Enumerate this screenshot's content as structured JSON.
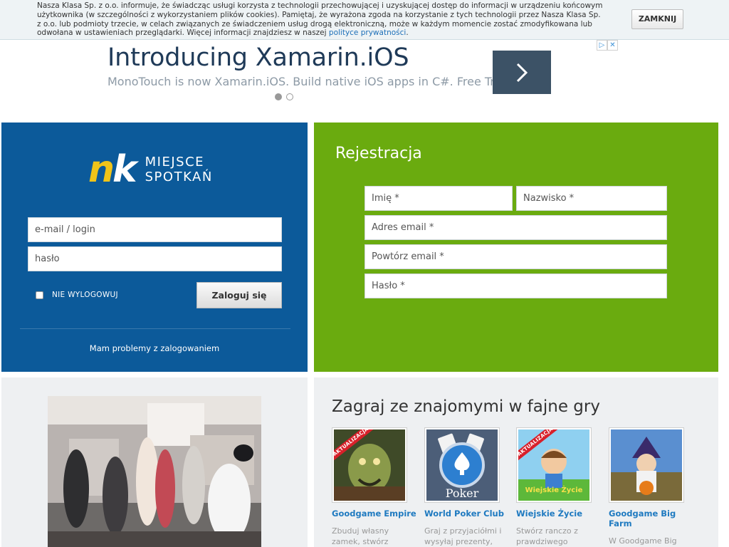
{
  "cookie_bar": {
    "text": "Nasza Klasa Sp. z o.o. informuje, że świadcząc usługi korzysta z technologii przechowującej i uzyskującej dostęp do informacji w urządzeniu końcowym użytkownika (w szczególności z wykorzystaniem plików cookies). Pamiętaj, że wyrażona zgoda na korzystanie z tych technologii przez Nasza Klasa Sp. z o.o. lub podmioty trzecie, w celach związanych ze świadczeniem usług drogą elektroniczną, może w każdym momencie zostać zmodyfikowana lub odwołana w ustawieniach przeglądarki. Więcej informacji znajdziesz w naszej ",
    "link": "polityce prywatności",
    "suffix": ".",
    "close_label": "ZAMKNIJ"
  },
  "ad": {
    "title": "Introducing Xamarin.iOS",
    "subtitle": "MonoTouch is now Xamarin.iOS. Build native iOS apps in C#. Free Trial."
  },
  "login": {
    "logo_text": "nk",
    "tagline_1": "MIEJSCE",
    "tagline_2": "SPOTKAŃ",
    "email_placeholder": "e-mail / login",
    "password_placeholder": "hasło",
    "remember_label": "NIE WYLOGOWUJ",
    "submit_label": "Zaloguj się",
    "help_link": "Mam problemy z zalogowaniem"
  },
  "register": {
    "title": "Rejestracja",
    "first_name": "Imię *",
    "last_name": "Nazwisko *",
    "email": "Adres email *",
    "email_repeat": "Powtórz email *",
    "password": "Hasło *"
  },
  "games": {
    "title": "Zagraj ze znajomymi w fajne gry",
    "badge": "AKTUALIZACJA",
    "items": [
      {
        "name": "Goodgame Empire",
        "desc": "Zbuduj własny zamek, stwórz"
      },
      {
        "name": "World Poker Club",
        "desc": "Graj z przyjaciółmi i wysyłaj prezenty,"
      },
      {
        "name": "Wiejskie Życie",
        "desc": "Stwórz ranczo z prawdziwego"
      },
      {
        "name": "Goodgame Big Farm",
        "desc": "W Goodgame Big"
      }
    ],
    "poker_logo": "Poker",
    "farm_logo": "Wiejskie Życie"
  },
  "colors": {
    "login_bg": "#0c5a9a",
    "register_bg": "#6aab0f",
    "logo_yellow": "#f0c419",
    "link_blue": "#1f7ac0"
  }
}
